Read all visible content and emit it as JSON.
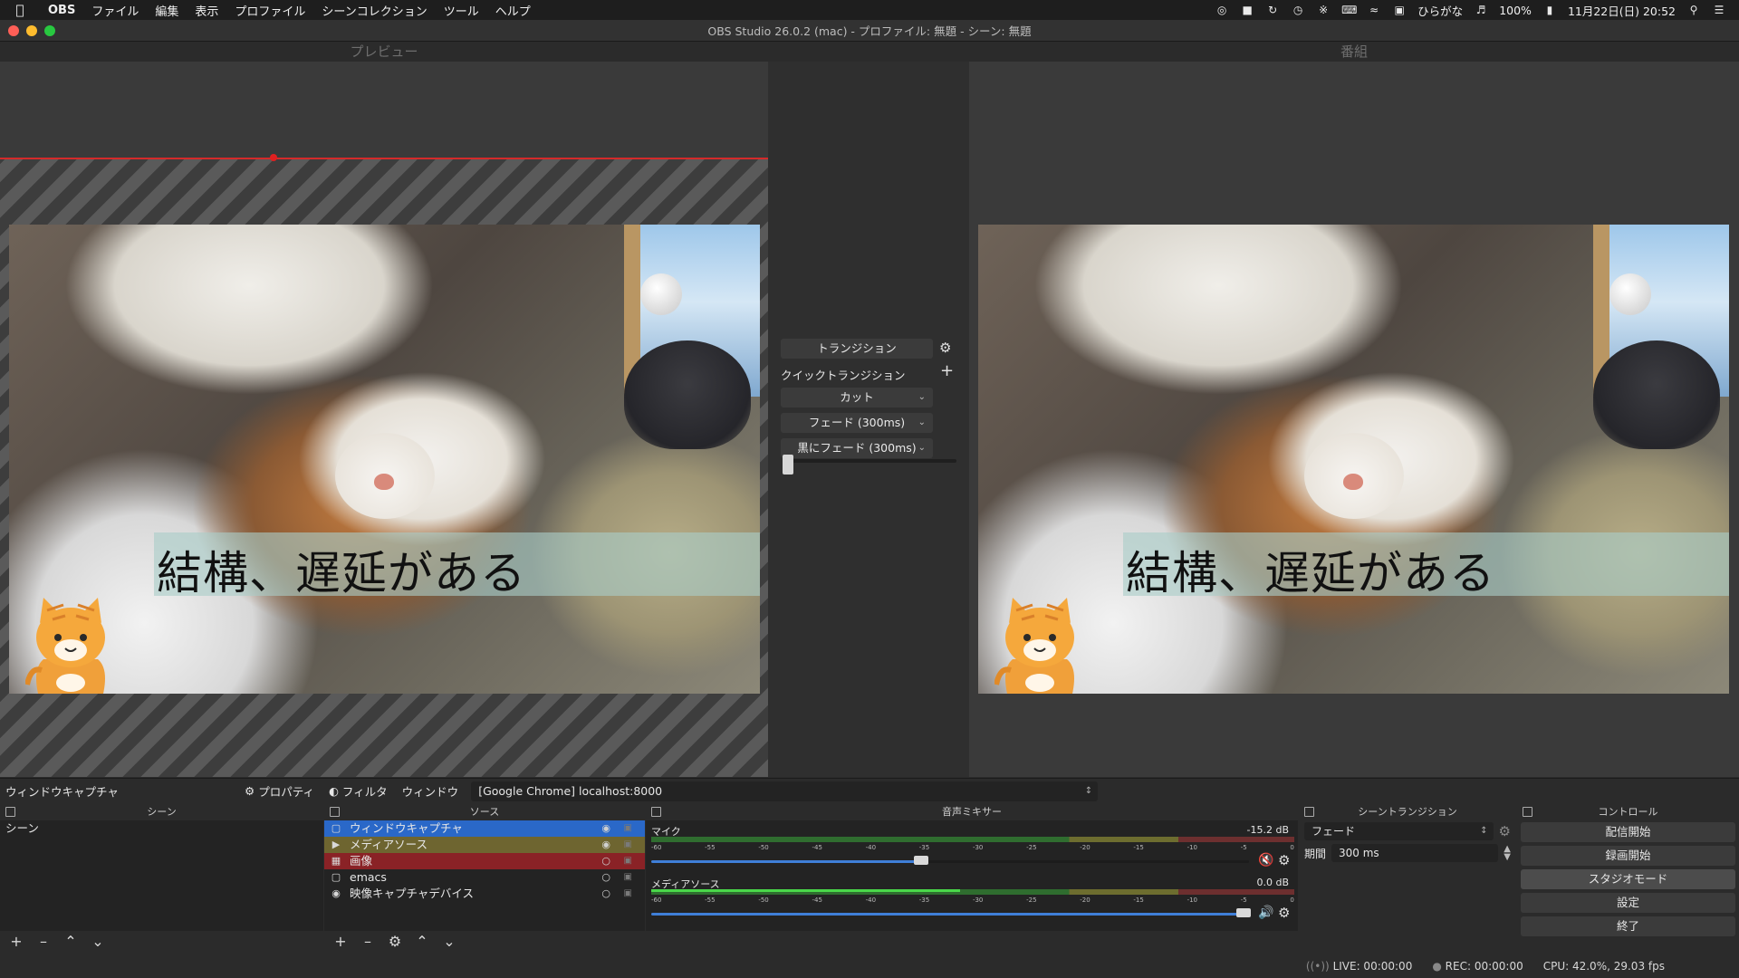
{
  "menubar": {
    "app": "OBS",
    "items": [
      "ファイル",
      "編集",
      "表示",
      "プロファイル",
      "シーンコレクション",
      "ツール",
      "ヘルプ"
    ],
    "ime": "ひらがな",
    "battery": "100%",
    "datetime": "11月22日(日) 20:52"
  },
  "window": {
    "title": "OBS Studio 26.0.2 (mac) - プロファイル: 無題 - シーン: 無題"
  },
  "preview": {
    "label": "プレビュー",
    "caption": "結構、遅延がある"
  },
  "program": {
    "label": "番組",
    "caption": "結構、遅延がある"
  },
  "transitions": {
    "transition_button": "トランジション",
    "quick_label": "クイックトランジション",
    "quick": [
      "カット",
      "フェード (300ms)",
      "黒にフェード (300ms)"
    ]
  },
  "context": {
    "source_name": "ウィンドウキャプチャ",
    "properties": "プロパティ",
    "filters": "フィルタ",
    "window_label": "ウィンドウ",
    "window_value": "[Google Chrome] localhost:8000"
  },
  "docks": {
    "scenes": {
      "title": "シーン",
      "items": [
        "シーン"
      ]
    },
    "sources": {
      "title": "ソース",
      "items": [
        {
          "name": "ウィンドウキャプチャ",
          "icon": "window-icon"
        },
        {
          "name": "メディアソース",
          "icon": "play-icon"
        },
        {
          "name": "画像",
          "icon": "image-icon"
        },
        {
          "name": "emacs",
          "icon": "window-icon"
        },
        {
          "name": "映像キャプチャデバイス",
          "icon": "camera-icon"
        }
      ]
    },
    "mixer": {
      "title": "音声ミキサー",
      "channels": [
        {
          "name": "マイク",
          "db": "-15.2 dB",
          "muted": true,
          "volume": 0.45
        },
        {
          "name": "メディアソース",
          "db": "0.0 dB",
          "muted": false,
          "volume": 1.0
        }
      ],
      "scale": [
        "-60",
        "-55",
        "-50",
        "-45",
        "-40",
        "-35",
        "-30",
        "-25",
        "-20",
        "-15",
        "-10",
        "-5",
        "0"
      ]
    },
    "scene_transitions": {
      "title": "シーントランジション",
      "selected": "フェード",
      "duration_label": "期間",
      "duration_value": "300 ms"
    },
    "controls": {
      "title": "コントロール",
      "buttons": [
        "配信開始",
        "録画開始",
        "スタジオモード",
        "設定",
        "終了"
      ]
    }
  },
  "status": {
    "live": "LIVE: 00:00:00",
    "rec": "REC: 00:00:00",
    "cpu": "CPU: 42.0%, 29.03 fps"
  },
  "colors": {
    "accent_selected": "#2a68c8",
    "source_olive": "#6e6530",
    "source_maroon": "#8a2226",
    "safe_line": "#d42a2a"
  }
}
